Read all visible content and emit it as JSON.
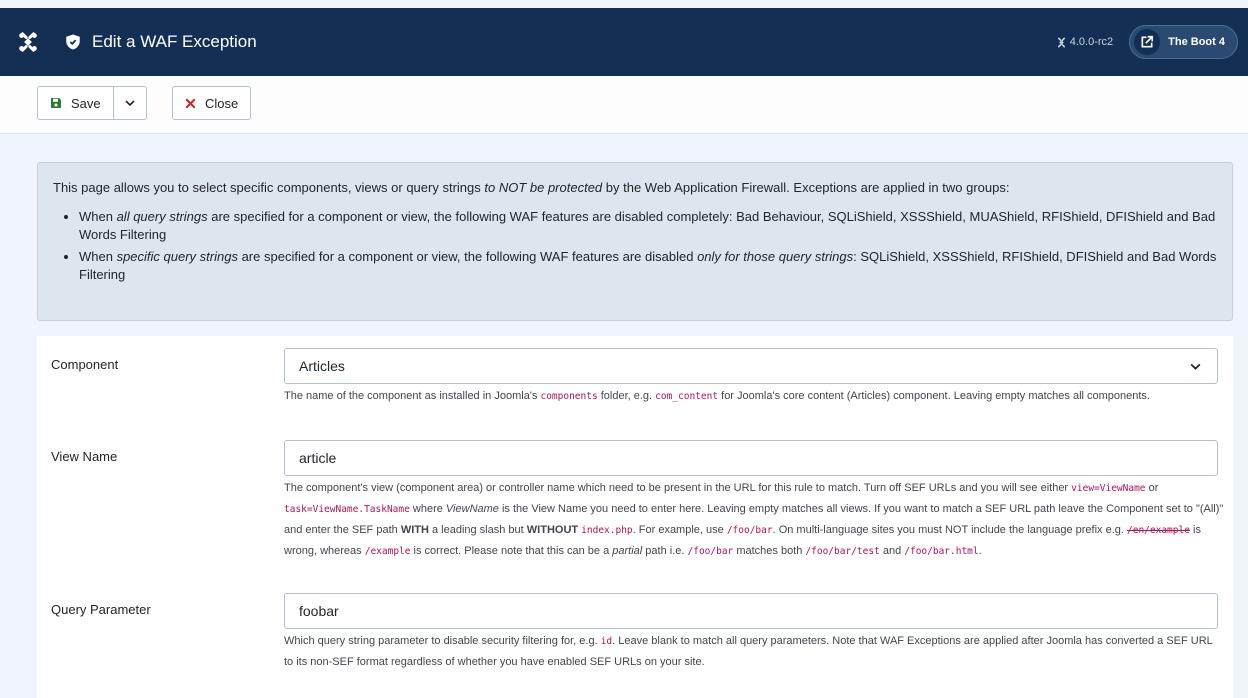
{
  "header": {
    "title": "Edit a WAF Exception",
    "version": "4.0.0-rc2",
    "site_name": "The Boot 4"
  },
  "toolbar": {
    "save_label": "Save",
    "close_label": "Close"
  },
  "alert": {
    "intro_before": "This page allows you to select specific components, views or query strings ",
    "intro_em": "to NOT be protected",
    "intro_after": " by the Web Application Firewall. Exceptions are applied in two groups:",
    "bullet1_before": "When ",
    "bullet1_em": "all query strings",
    "bullet1_after": " are specified for a component or view, the following WAF features are disabled completely: Bad Behaviour, SQLiShield, XSSShield, MUAShield, RFIShield, DFIShield and Bad Words Filtering",
    "bullet2_before": "When ",
    "bullet2_em": "specific query strings",
    "bullet2_mid": " are specified for a component or view, the following WAF features are disabled ",
    "bullet2_em2": "only for those query strings",
    "bullet2_after": ": SQLiShield, XSSShield, RFIShield, DFIShield and Bad Words Filtering"
  },
  "form": {
    "component": {
      "label": "Component",
      "value": "Articles",
      "help": {
        "t1": "The name of the component as installed in Joomla's ",
        "c1": "components",
        "t2": " folder, e.g. ",
        "c2": "com_content",
        "t3": " for Joomla's core content (Articles) component. Leaving empty matches all components."
      }
    },
    "view": {
      "label": "View Name",
      "value": "article",
      "help": {
        "t1": "The component's view (component area) or controller name which need to be present in the URL for this rule to match. Turn off SEF URLs and you will see either ",
        "c1": "view=ViewName",
        "t2": " or ",
        "c2": "task=ViewName.TaskName",
        "t3": " where ",
        "em1": "ViewName",
        "t4": " is the View Name you need to enter here. Leaving empty matches all views. If you want to match a SEF URL path leave the Component set to \"(All)\" and enter the SEF path ",
        "b1": "WITH",
        "t5": " a leading slash but ",
        "b2": "WITHOUT",
        "t6": " ",
        "c3": "index.php",
        "t7": ". For example, use ",
        "c4": "/foo/bar",
        "t8": ". On multi-language sites you must NOT include the language prefix e.g. ",
        "c5": "/en/example",
        "t9": " is wrong, whereas ",
        "c6": "/example",
        "t10": " is correct. Please note that this can be a ",
        "em2": "partial",
        "t11": " path i.e. ",
        "c7": "/foo/bar",
        "t12": " matches both ",
        "c8": "/foo/bar/test",
        "t13": " and ",
        "c9": "/foo/bar.html",
        "t14": "."
      }
    },
    "query": {
      "label": "Query Parameter",
      "value": "foobar",
      "help": {
        "t1": "Which query string parameter to disable security filtering for, e.g. ",
        "c1": "id",
        "t2": ". Leave blank to match all query parameters. Note that WAF Exceptions are applied after Joomla has converted a SEF URL to its non-SEF format regardless of whether you have enabled SEF URLs on your site."
      }
    }
  },
  "colors": {
    "header_bg": "#132f53",
    "save_icon": "#2a7a3c",
    "close_icon": "#c52827",
    "code": "#b2125a",
    "alert_bg": "#dde5ef"
  }
}
